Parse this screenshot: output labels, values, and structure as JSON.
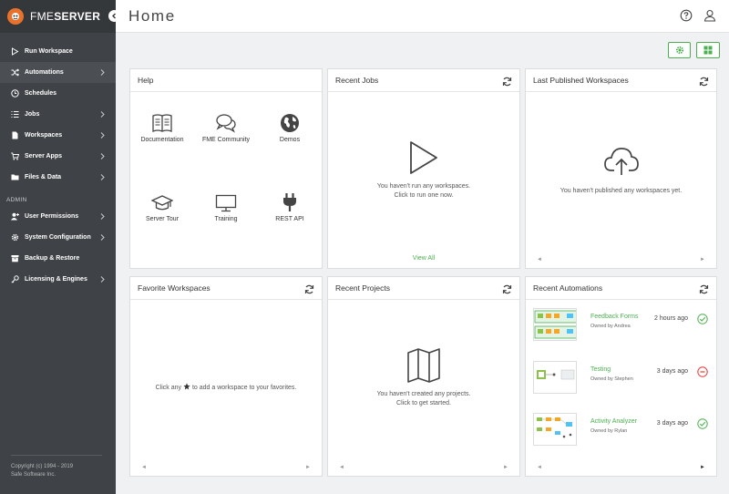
{
  "brand": {
    "light": "FME",
    "bold": "SERVER"
  },
  "page_title": "Home",
  "nav": [
    {
      "label": "Run Workspace",
      "icon": "play-icon",
      "chevron": false
    },
    {
      "label": "Automations",
      "icon": "shuffle-icon",
      "chevron": true
    },
    {
      "label": "Schedules",
      "icon": "clock-icon",
      "chevron": false
    },
    {
      "label": "Jobs",
      "icon": "list-icon",
      "chevron": true
    },
    {
      "label": "Workspaces",
      "icon": "file-icon",
      "chevron": true
    },
    {
      "label": "Server Apps",
      "icon": "cart-icon",
      "chevron": true
    },
    {
      "label": "Files & Data",
      "icon": "folder-icon",
      "chevron": true
    }
  ],
  "admin_label": "ADMIN",
  "admin_nav": [
    {
      "label": "User Permissions",
      "icon": "user-plus-icon",
      "chevron": true
    },
    {
      "label": "System Configuration",
      "icon": "cog-icon",
      "chevron": true
    },
    {
      "label": "Backup & Restore",
      "icon": "archive-icon",
      "chevron": false
    },
    {
      "label": "Licensing & Engines",
      "icon": "key-icon",
      "chevron": true
    }
  ],
  "copyright": {
    "line1": "Copyright (c) 1994 - 2019",
    "line2": "Safe Software Inc."
  },
  "cards": {
    "help": {
      "title": "Help",
      "tiles": [
        {
          "label": "Documentation",
          "icon": "book-icon"
        },
        {
          "label": "FME Community",
          "icon": "chat-icon"
        },
        {
          "label": "Demos",
          "icon": "globe-icon"
        },
        {
          "label": "Server Tour",
          "icon": "graduation-cap-icon"
        },
        {
          "label": "Training",
          "icon": "monitor-icon"
        },
        {
          "label": "REST API",
          "icon": "plug-icon"
        }
      ]
    },
    "recent_jobs": {
      "title": "Recent Jobs",
      "msg1": "You haven't run any workspaces.",
      "msg2": "Click to run one now.",
      "view_all": "View All"
    },
    "last_published": {
      "title": "Last Published Workspaces",
      "msg": "You haven't published any workspaces yet."
    },
    "favorites": {
      "title": "Favorite Workspaces",
      "msg_before": "Click any",
      "msg_after": "to add a workspace to your favorites."
    },
    "recent_projects": {
      "title": "Recent Projects",
      "msg1": "You haven't created any projects.",
      "msg2": "Click to get started."
    },
    "recent_automations": {
      "title": "Recent Automations",
      "items": [
        {
          "name": "Feedback Forms",
          "owner": "Owned by Andrea",
          "time": "2 hours ago",
          "status": "success"
        },
        {
          "name": "Testing",
          "owner": "Owned by Stephen",
          "time": "3 days ago",
          "status": "stopped"
        },
        {
          "name": "Activity Analyzer",
          "owner": "Owned by Rylan",
          "time": "3 days ago",
          "status": "success"
        }
      ]
    }
  },
  "pager": {
    "prev": "◄",
    "next": "►"
  },
  "colors": {
    "accent": "#4caf50",
    "sidebar": "#3f4246",
    "error": "#e53935",
    "brand_orange": "#e8722c"
  }
}
